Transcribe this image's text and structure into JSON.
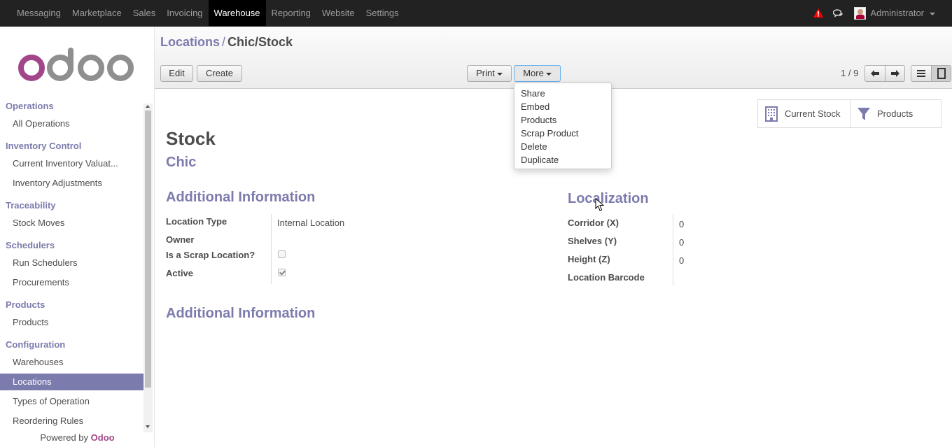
{
  "navbar": {
    "menu": [
      "Messaging",
      "Marketplace",
      "Sales",
      "Invoicing",
      "Warehouse",
      "Reporting",
      "Website",
      "Settings"
    ],
    "active": "Warehouse",
    "user": "Administrator",
    "icons": [
      "alert-icon",
      "chat-icon",
      "avatar"
    ],
    "alert_color": "#ff0000"
  },
  "sidebar": {
    "sections": [
      {
        "title": "Operations",
        "items": [
          "All Operations"
        ]
      },
      {
        "title": "Inventory Control",
        "items": [
          "Current Inventory Valuat...",
          "Inventory Adjustments"
        ]
      },
      {
        "title": "Traceability",
        "items": [
          "Stock Moves"
        ]
      },
      {
        "title": "Schedulers",
        "items": [
          "Run Schedulers",
          "Procurements"
        ]
      },
      {
        "title": "Products",
        "items": [
          "Products"
        ]
      },
      {
        "title": "Configuration",
        "items": [
          "Warehouses",
          "Locations",
          "Types of Operation",
          "Reordering Rules"
        ]
      }
    ],
    "active_item": "Locations",
    "powered_prefix": "Powered by",
    "powered_brand": "Odoo"
  },
  "breadcrumb": {
    "parent": "Locations",
    "separator": "/",
    "current": "Chic/Stock"
  },
  "buttons": {
    "edit": "Edit",
    "create": "Create",
    "print": "Print",
    "more": "More"
  },
  "pager": {
    "value": "1 / 9"
  },
  "more_menu": [
    "Share",
    "Embed",
    "Products",
    "Scrap Product",
    "Delete",
    "Duplicate"
  ],
  "smart_buttons": {
    "current_stock": "Current Stock",
    "products": "Products"
  },
  "record": {
    "name": "Stock",
    "parent": "Chic",
    "additional_info_title": "Additional Information",
    "localization_title": "Localization",
    "second_section_title": "Additional Information",
    "fields": {
      "location_type_label": "Location Type",
      "location_type_value": "Internal Location",
      "owner_label": "Owner",
      "scrap_label": "Is a Scrap Location?",
      "scrap_value": false,
      "active_label": "Active",
      "active_value": true,
      "corridor_label": "Corridor (X)",
      "corridor_value": "0",
      "shelves_label": "Shelves (Y)",
      "shelves_value": "0",
      "height_label": "Height (Z)",
      "height_value": "0",
      "barcode_label": "Location Barcode"
    }
  },
  "colors": {
    "accent": "#7c7bad",
    "brand": "#a24689",
    "navbar": "#222222"
  }
}
